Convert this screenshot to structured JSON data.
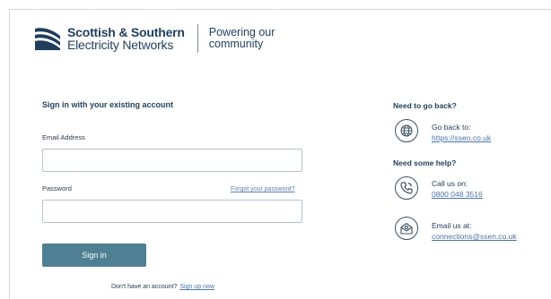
{
  "brand": {
    "name_line1": "Scottish & Southern",
    "name_line2": "Electricity Networks",
    "tagline_line1": "Powering our",
    "tagline_line2": "community",
    "color": "#1f3d5c"
  },
  "signin": {
    "title": "Sign in with your existing account",
    "email_label": "Email Address",
    "email_value": "",
    "password_label": "Password",
    "password_value": "",
    "forgot_link": "Forgot your password?",
    "button_label": "Sign in",
    "button_color": "#4f7f93",
    "no_account_text": "Don't have an account?",
    "signup_link": "Sign up now"
  },
  "help": {
    "back_heading": "Need to go back?",
    "back_label": "Go back to:",
    "back_link": "https://ssen.co.uk",
    "help_heading": "Need some help?",
    "call_label": "Call us on:",
    "call_number": "0800 048 3516",
    "email_label": "Email us at:",
    "email_address": "connections@ssen.co.uk"
  },
  "icons": [
    "ssen-logo-icon",
    "globe-icon",
    "phone-icon",
    "mail-icon"
  ],
  "colors": {
    "link": "#4a74a6",
    "text": "#1f3d5c"
  }
}
